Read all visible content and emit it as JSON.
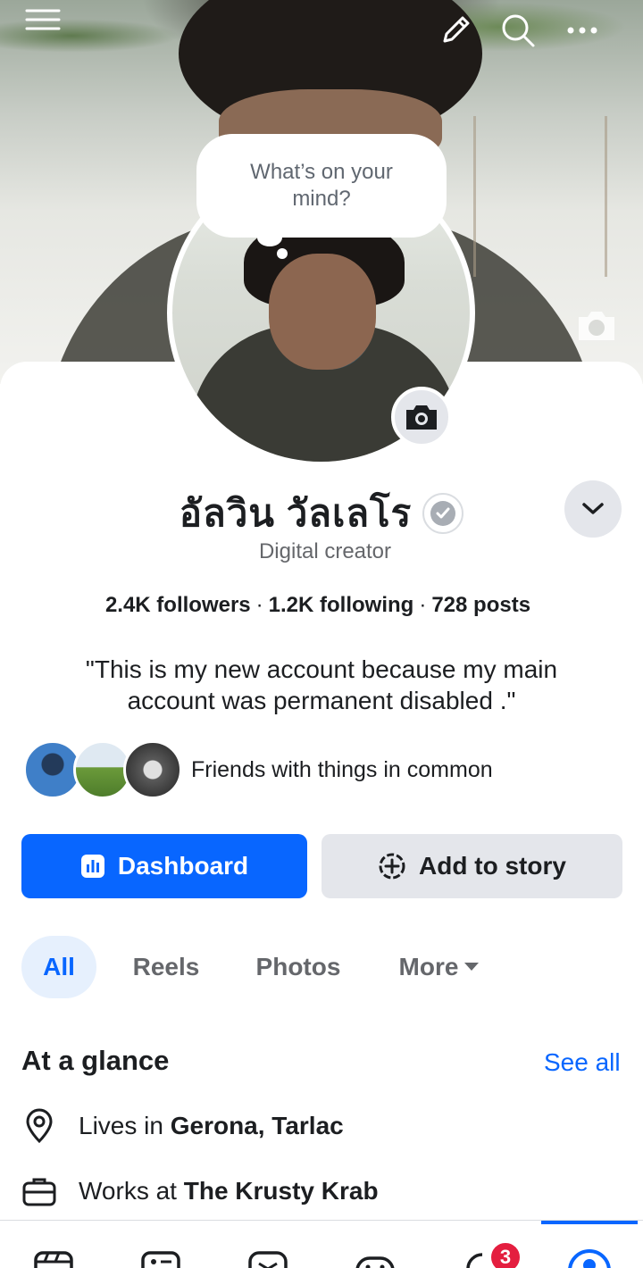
{
  "cover": {
    "menu_icon": "hamburger-menu-icon",
    "edit_icon": "pencil-icon",
    "search_icon": "search-icon",
    "more_icon": "more-dots-icon",
    "camera_icon": "camera-icon"
  },
  "bubble": {
    "text": "What’s on your mind?"
  },
  "profile": {
    "name": "อัลวิน วัลเลโร",
    "subtitle": "Digital creator",
    "followers": "2.4K followers",
    "following": "1.2K following",
    "posts": "728 posts",
    "separator": "·",
    "bio": "\"This is my new account because my main account was permanent disabled .\""
  },
  "friends": {
    "text": "Friends with things in common"
  },
  "actions": {
    "dashboard": "Dashboard",
    "add_story": "Add to story"
  },
  "tabs": [
    "All",
    "Reels",
    "Photos",
    "More"
  ],
  "glance": {
    "title": "At a glance",
    "see_all": "See all",
    "lives_prefix": "Lives in ",
    "lives_value": "Gerona, Tarlac",
    "works_prefix": "Works at ",
    "works_value": "The Krusty Krab"
  },
  "bottom_nav": {
    "notification_badge": "3",
    "items": [
      "home-icon",
      "feed-icon",
      "messages-icon",
      "gaming-icon",
      "notifications-icon",
      "profile-icon"
    ]
  },
  "colors": {
    "accent": "#0866ff",
    "badge": "#e41e3f",
    "muted": "#65676b"
  }
}
